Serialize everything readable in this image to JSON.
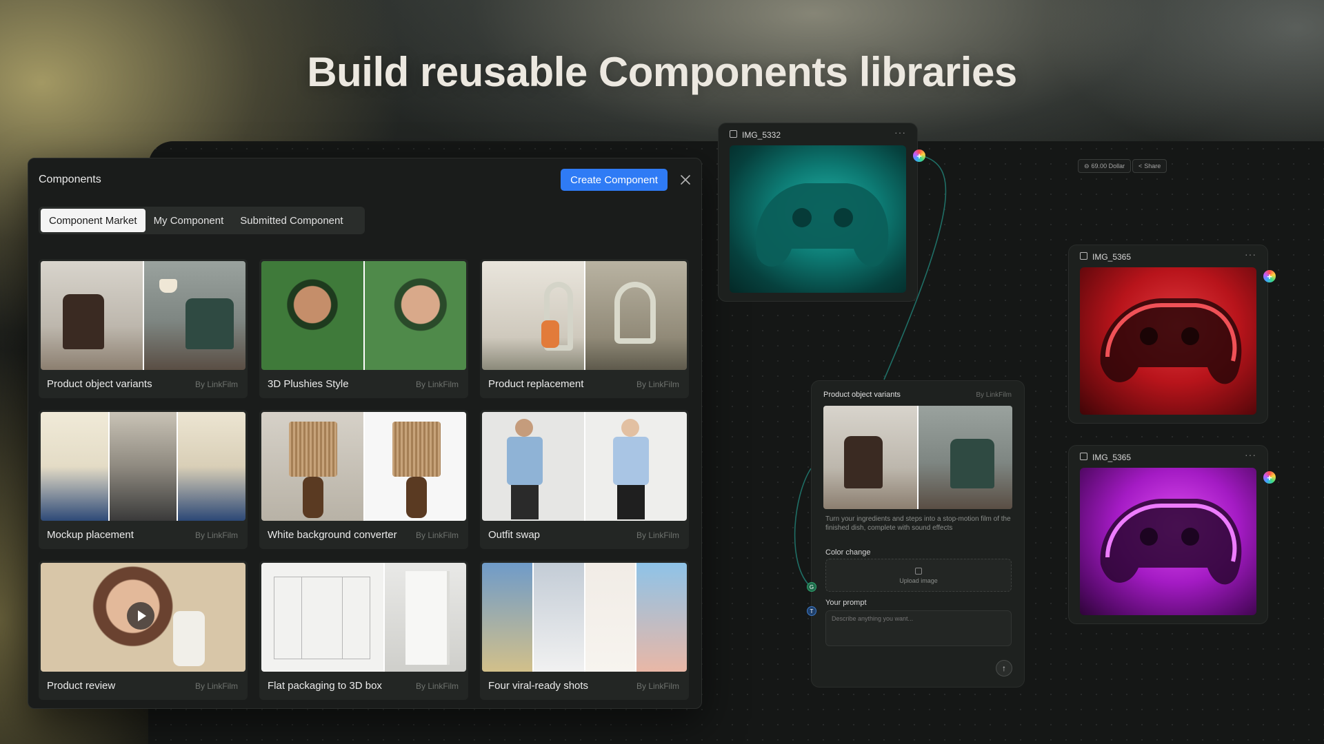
{
  "headline": "Build reusable Components libraries",
  "panel": {
    "title": "Components",
    "create_label": "Create Component",
    "tabs": [
      {
        "label": "Component Market",
        "active": true
      },
      {
        "label": "My Component",
        "active": false
      },
      {
        "label": "Submitted Component",
        "active": false
      }
    ],
    "cards": [
      {
        "name": "Product object variants",
        "by": "By LinkFilm"
      },
      {
        "name": "3D Plushies Style",
        "by": "By LinkFilm"
      },
      {
        "name": "Product replacement",
        "by": "By LinkFilm"
      },
      {
        "name": "Mockup placement",
        "by": "By LinkFilm"
      },
      {
        "name": "White background converter",
        "by": "By LinkFilm"
      },
      {
        "name": "Outfit swap",
        "by": "By LinkFilm"
      },
      {
        "name": "Product review",
        "by": "By LinkFilm"
      },
      {
        "name": "Flat packaging to 3D box",
        "by": "By LinkFilm"
      },
      {
        "name": "Four viral-ready shots",
        "by": "By LinkFilm"
      }
    ]
  },
  "nodes": {
    "teal": {
      "title": "IMG_5332"
    },
    "red": {
      "title": "IMG_5365"
    },
    "purple": {
      "title": "IMG_5365"
    }
  },
  "toolbar": {
    "cost": "69.00 Dollar",
    "share": "Share"
  },
  "workflow": {
    "title": "Product object variants",
    "by": "By LinkFilm",
    "description": "Turn your ingredients and steps into a stop-motion film of the finished dish, complete with sound effects",
    "color_label": "Color change",
    "upload_label": "Upload image",
    "prompt_label": "Your prompt",
    "prompt_placeholder": "Describe anything you want..."
  },
  "colors": {
    "accent": "#2f7bf5",
    "teal": "#0f8a84",
    "red": "#d3222b",
    "purple": "#b21fd0"
  }
}
